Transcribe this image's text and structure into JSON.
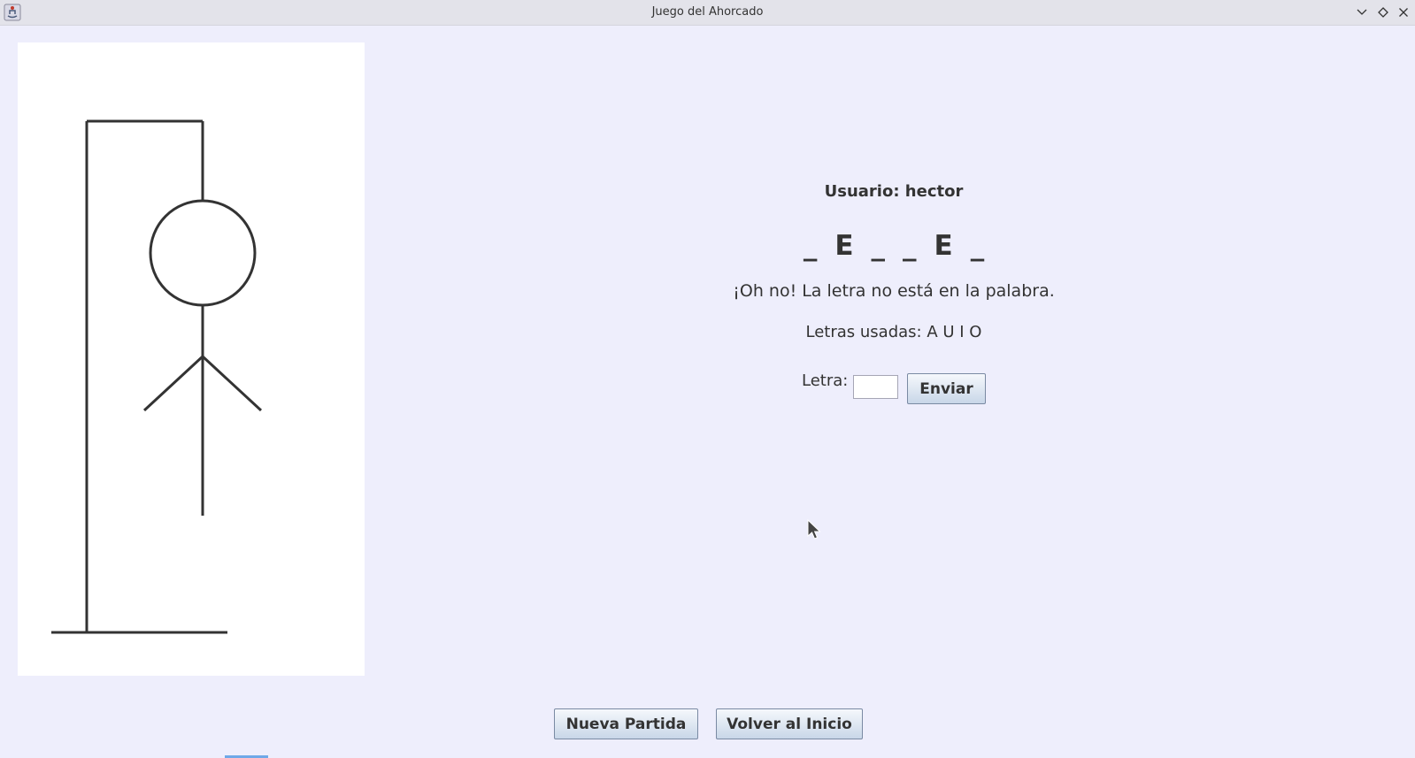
{
  "window": {
    "title": "Juego del Ahorcado",
    "controls": [
      "minimize",
      "maximize",
      "close"
    ]
  },
  "icons": {
    "app": "java-app-icon",
    "minimize": "chevron-down-icon",
    "maximize": "diamond-icon",
    "close": "close-icon"
  },
  "game": {
    "user_label": "Usuario: hector",
    "word_slots": [
      "_",
      "E",
      "_",
      "_",
      "E",
      "_"
    ],
    "message": "¡Oh no! La letra no está en la palabra.",
    "used_letters": "Letras usadas: A U I O",
    "letter_label": "Letra:",
    "letter_value": "",
    "send_button": "Enviar"
  },
  "footer": {
    "new_game_button": "Nueva Partida",
    "back_button": "Volver al Inicio"
  },
  "hangman": {
    "parts_shown": [
      "base",
      "pole",
      "beam",
      "rope",
      "head",
      "body",
      "left-arm",
      "right-arm"
    ],
    "stroke_color": "#333333"
  },
  "colors": {
    "window_bg": "#eeeefc",
    "panel_bg": "#ffffff",
    "text": "#333333",
    "button_border": "#7a8aa3"
  }
}
